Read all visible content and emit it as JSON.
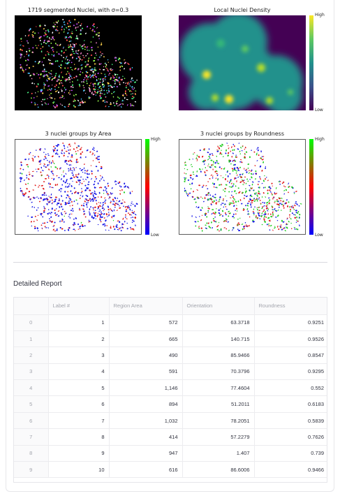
{
  "plots": {
    "segmented": {
      "title": "1719 segmented Nuclei, with σ=0.3"
    },
    "density": {
      "title": "Local Nuclei Density",
      "cbar_high": "High",
      "cbar_low": "Low"
    },
    "area": {
      "title": "3 nuclei groups by Area",
      "cbar_high": "High",
      "cbar_low": "Low"
    },
    "roundness": {
      "title": "3 nuclei groups by Roundness",
      "cbar_high": "High",
      "cbar_low": "Low"
    }
  },
  "colors": {
    "group_low": "#1515e6",
    "group_mid": "#e01818",
    "group_high": "#22cc22",
    "density_bg": "#440154",
    "density_mid": "#21918c",
    "density_high": "#fde725"
  },
  "report": {
    "title": "Detailed Report",
    "columns": [
      "",
      "Label #",
      "Region Area",
      "Orientation",
      "Roundness"
    ],
    "rows": [
      [
        "0",
        "1",
        "572",
        "63.3718",
        "0.9251"
      ],
      [
        "1",
        "2",
        "665",
        "140.715",
        "0.9526"
      ],
      [
        "2",
        "3",
        "490",
        "85.9466",
        "0.8547"
      ],
      [
        "3",
        "4",
        "591",
        "70.3796",
        "0.9295"
      ],
      [
        "4",
        "5",
        "1,146",
        "77.4604",
        "0.552"
      ],
      [
        "5",
        "6",
        "894",
        "51.2011",
        "0.6183"
      ],
      [
        "6",
        "7",
        "1,032",
        "78.2051",
        "0.5839"
      ],
      [
        "7",
        "8",
        "414",
        "57.2279",
        "0.7626"
      ],
      [
        "8",
        "9",
        "947",
        "1.407",
        "0.739"
      ],
      [
        "9",
        "10",
        "616",
        "86.6006",
        "0.9466"
      ]
    ]
  }
}
